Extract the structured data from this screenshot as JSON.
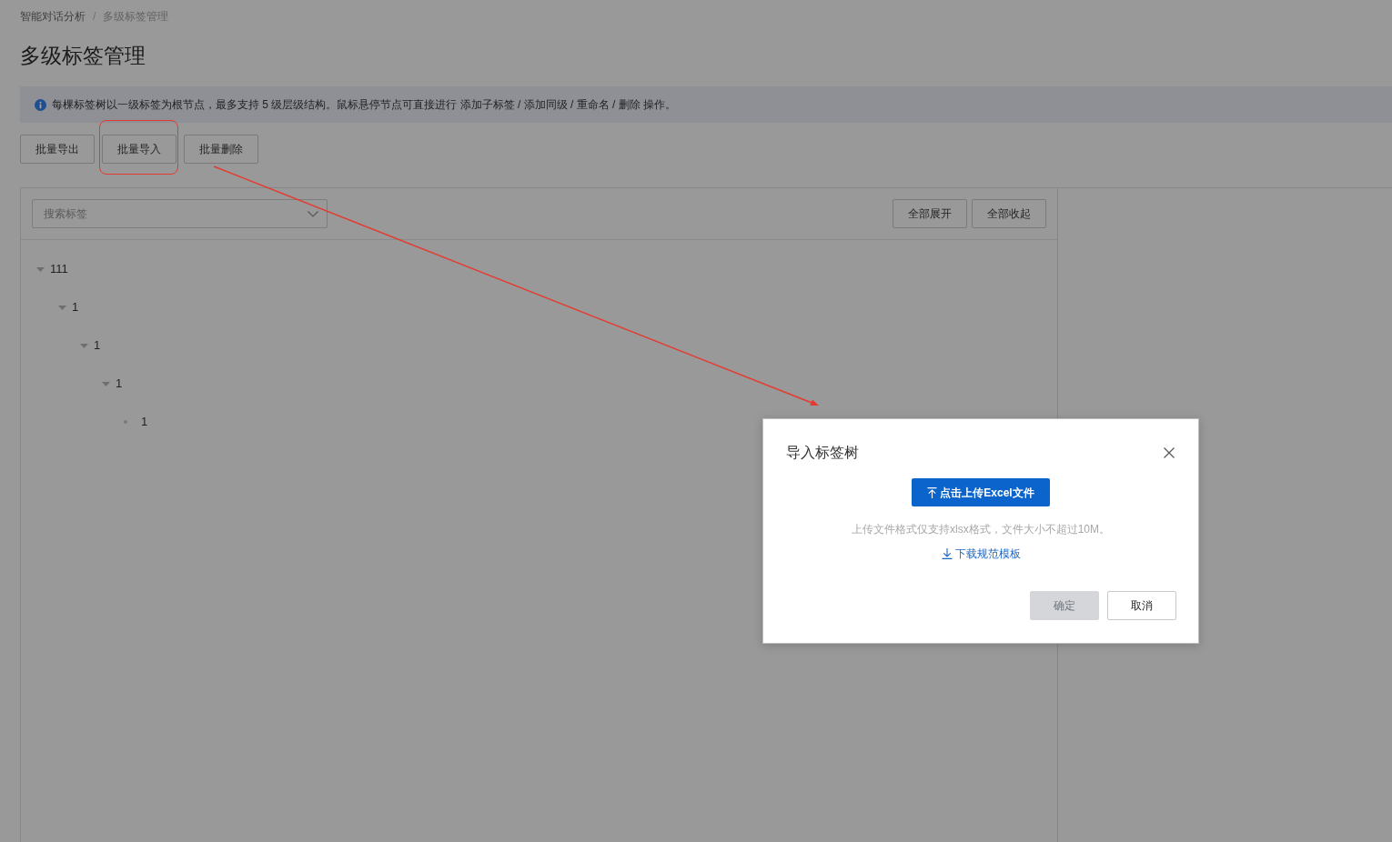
{
  "breadcrumb": {
    "separator": "/",
    "items": [
      {
        "label": "智能对话分析",
        "current": false
      },
      {
        "label": "多级标签管理",
        "current": true
      }
    ]
  },
  "page_title": "多级标签管理",
  "notice": {
    "text": "每棵标签树以一级标签为根节点，最多支持 5 级层级结构。鼠标悬停节点可直接进行 添加子标签 / 添加同级 / 重命名 / 删除 操作。"
  },
  "toolbar": [
    {
      "label": "批量导出",
      "highlighted": false
    },
    {
      "label": "批量导入",
      "highlighted": true
    },
    {
      "label": "批量删除",
      "highlighted": false
    }
  ],
  "tree_panel": {
    "search": {
      "placeholder": "搜索标签"
    },
    "actions": [
      "全部展开",
      "全部收起"
    ],
    "nodes": [
      {
        "label": "111",
        "expanded": true,
        "children": [
          {
            "label": "1",
            "expanded": true,
            "children": [
              {
                "label": "1",
                "expanded": true,
                "children": [
                  {
                    "label": "1",
                    "expanded": true,
                    "children": [
                      {
                        "label": "1"
                      }
                    ]
                  }
                ]
              }
            ]
          }
        ]
      }
    ]
  },
  "dialog": {
    "title": "导入标签树",
    "upload_button": "点击上传Excel文件",
    "hint": "上传文件格式仅支持xlsx格式，文件大小不超过10M。",
    "template_link": "下载规范模板",
    "buttons": [
      {
        "label": "确定",
        "kind": "primary",
        "disabled": true
      },
      {
        "label": "取消",
        "kind": "default",
        "disabled": false
      }
    ]
  }
}
